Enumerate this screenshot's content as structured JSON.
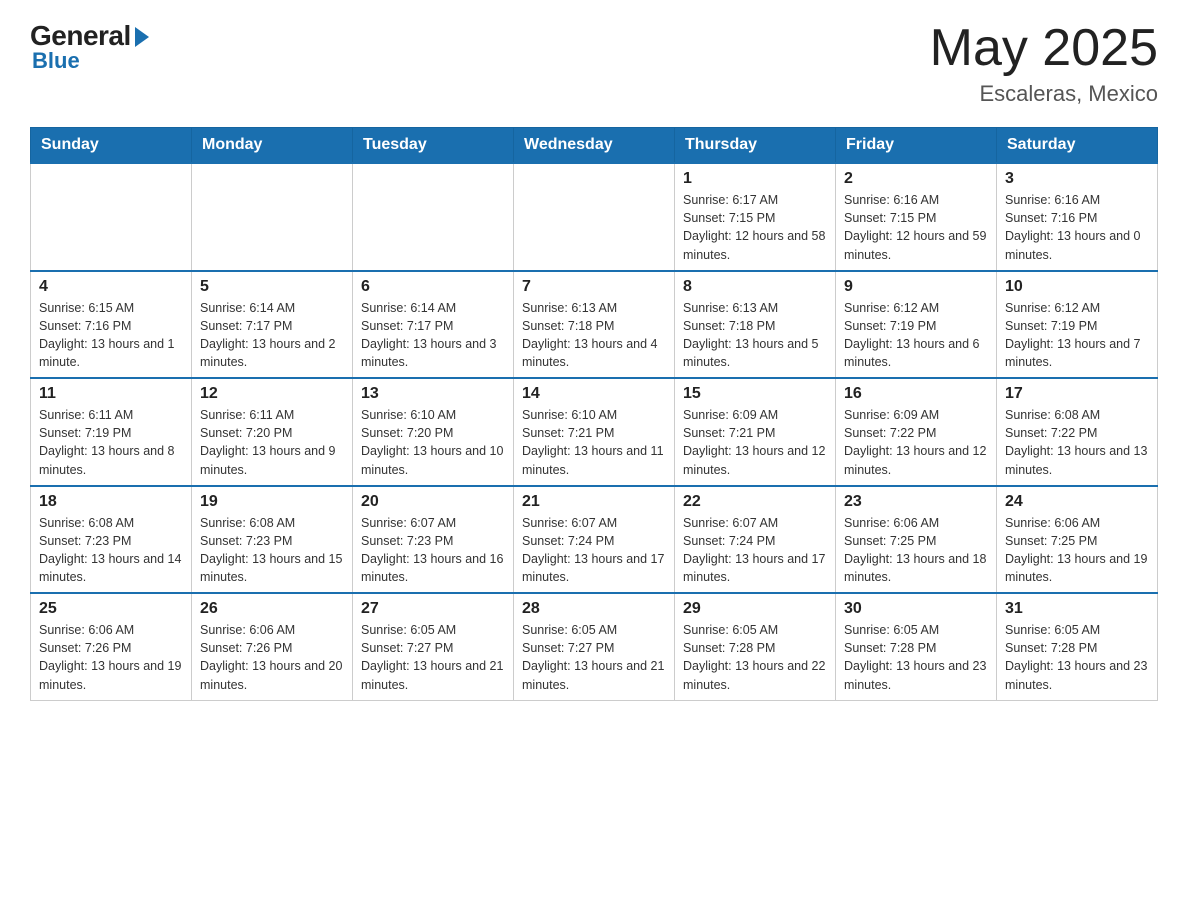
{
  "header": {
    "logo_general": "General",
    "logo_blue": "Blue",
    "month_year": "May 2025",
    "location": "Escaleras, Mexico"
  },
  "days_of_week": [
    "Sunday",
    "Monday",
    "Tuesday",
    "Wednesday",
    "Thursday",
    "Friday",
    "Saturday"
  ],
  "weeks": [
    [
      {
        "day": "",
        "sunrise": "",
        "sunset": "",
        "daylight": ""
      },
      {
        "day": "",
        "sunrise": "",
        "sunset": "",
        "daylight": ""
      },
      {
        "day": "",
        "sunrise": "",
        "sunset": "",
        "daylight": ""
      },
      {
        "day": "",
        "sunrise": "",
        "sunset": "",
        "daylight": ""
      },
      {
        "day": "1",
        "sunrise": "Sunrise: 6:17 AM",
        "sunset": "Sunset: 7:15 PM",
        "daylight": "Daylight: 12 hours and 58 minutes."
      },
      {
        "day": "2",
        "sunrise": "Sunrise: 6:16 AM",
        "sunset": "Sunset: 7:15 PM",
        "daylight": "Daylight: 12 hours and 59 minutes."
      },
      {
        "day": "3",
        "sunrise": "Sunrise: 6:16 AM",
        "sunset": "Sunset: 7:16 PM",
        "daylight": "Daylight: 13 hours and 0 minutes."
      }
    ],
    [
      {
        "day": "4",
        "sunrise": "Sunrise: 6:15 AM",
        "sunset": "Sunset: 7:16 PM",
        "daylight": "Daylight: 13 hours and 1 minute."
      },
      {
        "day": "5",
        "sunrise": "Sunrise: 6:14 AM",
        "sunset": "Sunset: 7:17 PM",
        "daylight": "Daylight: 13 hours and 2 minutes."
      },
      {
        "day": "6",
        "sunrise": "Sunrise: 6:14 AM",
        "sunset": "Sunset: 7:17 PM",
        "daylight": "Daylight: 13 hours and 3 minutes."
      },
      {
        "day": "7",
        "sunrise": "Sunrise: 6:13 AM",
        "sunset": "Sunset: 7:18 PM",
        "daylight": "Daylight: 13 hours and 4 minutes."
      },
      {
        "day": "8",
        "sunrise": "Sunrise: 6:13 AM",
        "sunset": "Sunset: 7:18 PM",
        "daylight": "Daylight: 13 hours and 5 minutes."
      },
      {
        "day": "9",
        "sunrise": "Sunrise: 6:12 AM",
        "sunset": "Sunset: 7:19 PM",
        "daylight": "Daylight: 13 hours and 6 minutes."
      },
      {
        "day": "10",
        "sunrise": "Sunrise: 6:12 AM",
        "sunset": "Sunset: 7:19 PM",
        "daylight": "Daylight: 13 hours and 7 minutes."
      }
    ],
    [
      {
        "day": "11",
        "sunrise": "Sunrise: 6:11 AM",
        "sunset": "Sunset: 7:19 PM",
        "daylight": "Daylight: 13 hours and 8 minutes."
      },
      {
        "day": "12",
        "sunrise": "Sunrise: 6:11 AM",
        "sunset": "Sunset: 7:20 PM",
        "daylight": "Daylight: 13 hours and 9 minutes."
      },
      {
        "day": "13",
        "sunrise": "Sunrise: 6:10 AM",
        "sunset": "Sunset: 7:20 PM",
        "daylight": "Daylight: 13 hours and 10 minutes."
      },
      {
        "day": "14",
        "sunrise": "Sunrise: 6:10 AM",
        "sunset": "Sunset: 7:21 PM",
        "daylight": "Daylight: 13 hours and 11 minutes."
      },
      {
        "day": "15",
        "sunrise": "Sunrise: 6:09 AM",
        "sunset": "Sunset: 7:21 PM",
        "daylight": "Daylight: 13 hours and 12 minutes."
      },
      {
        "day": "16",
        "sunrise": "Sunrise: 6:09 AM",
        "sunset": "Sunset: 7:22 PM",
        "daylight": "Daylight: 13 hours and 12 minutes."
      },
      {
        "day": "17",
        "sunrise": "Sunrise: 6:08 AM",
        "sunset": "Sunset: 7:22 PM",
        "daylight": "Daylight: 13 hours and 13 minutes."
      }
    ],
    [
      {
        "day": "18",
        "sunrise": "Sunrise: 6:08 AM",
        "sunset": "Sunset: 7:23 PM",
        "daylight": "Daylight: 13 hours and 14 minutes."
      },
      {
        "day": "19",
        "sunrise": "Sunrise: 6:08 AM",
        "sunset": "Sunset: 7:23 PM",
        "daylight": "Daylight: 13 hours and 15 minutes."
      },
      {
        "day": "20",
        "sunrise": "Sunrise: 6:07 AM",
        "sunset": "Sunset: 7:23 PM",
        "daylight": "Daylight: 13 hours and 16 minutes."
      },
      {
        "day": "21",
        "sunrise": "Sunrise: 6:07 AM",
        "sunset": "Sunset: 7:24 PM",
        "daylight": "Daylight: 13 hours and 17 minutes."
      },
      {
        "day": "22",
        "sunrise": "Sunrise: 6:07 AM",
        "sunset": "Sunset: 7:24 PM",
        "daylight": "Daylight: 13 hours and 17 minutes."
      },
      {
        "day": "23",
        "sunrise": "Sunrise: 6:06 AM",
        "sunset": "Sunset: 7:25 PM",
        "daylight": "Daylight: 13 hours and 18 minutes."
      },
      {
        "day": "24",
        "sunrise": "Sunrise: 6:06 AM",
        "sunset": "Sunset: 7:25 PM",
        "daylight": "Daylight: 13 hours and 19 minutes."
      }
    ],
    [
      {
        "day": "25",
        "sunrise": "Sunrise: 6:06 AM",
        "sunset": "Sunset: 7:26 PM",
        "daylight": "Daylight: 13 hours and 19 minutes."
      },
      {
        "day": "26",
        "sunrise": "Sunrise: 6:06 AM",
        "sunset": "Sunset: 7:26 PM",
        "daylight": "Daylight: 13 hours and 20 minutes."
      },
      {
        "day": "27",
        "sunrise": "Sunrise: 6:05 AM",
        "sunset": "Sunset: 7:27 PM",
        "daylight": "Daylight: 13 hours and 21 minutes."
      },
      {
        "day": "28",
        "sunrise": "Sunrise: 6:05 AM",
        "sunset": "Sunset: 7:27 PM",
        "daylight": "Daylight: 13 hours and 21 minutes."
      },
      {
        "day": "29",
        "sunrise": "Sunrise: 6:05 AM",
        "sunset": "Sunset: 7:28 PM",
        "daylight": "Daylight: 13 hours and 22 minutes."
      },
      {
        "day": "30",
        "sunrise": "Sunrise: 6:05 AM",
        "sunset": "Sunset: 7:28 PM",
        "daylight": "Daylight: 13 hours and 23 minutes."
      },
      {
        "day": "31",
        "sunrise": "Sunrise: 6:05 AM",
        "sunset": "Sunset: 7:28 PM",
        "daylight": "Daylight: 13 hours and 23 minutes."
      }
    ]
  ]
}
